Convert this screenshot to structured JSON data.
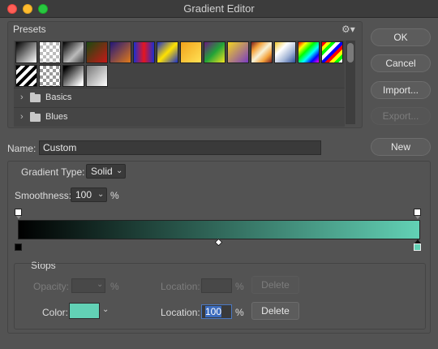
{
  "window": {
    "title": "Gradient Editor"
  },
  "presets": {
    "title": "Presets",
    "gear_icon": "gear-icon",
    "swatches": [
      "linear-gradient(135deg,#000,#fff)",
      "repeating-conic-gradient(#bbb 0 25%,#fff 0 50%) 0 0/8px 8px",
      "linear-gradient(135deg,#000,#bbb 60%,rgba(255,255,255,0))",
      "linear-gradient(135deg,#1b4a0f,#c81818)",
      "linear-gradient(135deg,#22177a,#e07a1a)",
      "linear-gradient(90deg,#1c2fd0,#e6151e,#1c2fd0)",
      "linear-gradient(135deg,#1b2fc9,#ffe200,#1b2fc9)",
      "linear-gradient(135deg,#f2a21b,#ffe255)",
      "linear-gradient(135deg,#6a1a7e,#22a338,#f3e521)",
      "linear-gradient(135deg,#f3d421,#7a3cc2)",
      "linear-gradient(135deg,#7a1e1e,#f4a23b,#f7f2d8,#f4a23b,#7a1e1e)",
      "linear-gradient(135deg,#f1c72c,#fff,#a3b5d6,#2d4f9a)",
      "linear-gradient(135deg,#ff0000,#ffff00,#00ff00,#00ffff,#0000ff,#ff00ff)",
      "repeating-linear-gradient(135deg,#ff0000 0 4px,#ffff00 4px 8px,#00ff00 8px 12px,#ffffff 12px 16px,#0000ff 16px 20px)",
      "repeating-linear-gradient(135deg,#000 0 4px,#fff 4px 8px)",
      "repeating-conic-gradient(#9a9a9a 0 25%,#fff 0 50%) 0 0/8px 8px",
      "linear-gradient(135deg,#000 10%,#fff 90%)",
      "linear-gradient(135deg,#777,#fff)"
    ],
    "folders": [
      {
        "label": "Basics"
      },
      {
        "label": "Blues"
      }
    ]
  },
  "buttons": {
    "ok": "OK",
    "cancel": "Cancel",
    "import": "Import...",
    "export": "Export...",
    "new": "New"
  },
  "name_field": {
    "label": "Name:",
    "value": "Custom"
  },
  "gradient": {
    "type_label": "Gradient Type:",
    "type_value": "Solid",
    "smoothness_label": "Smoothness:",
    "smoothness_value": "100",
    "smoothness_unit": "%",
    "start_color": "#000000",
    "end_color": "#62d1b5"
  },
  "stops": {
    "title": "Stops",
    "opacity_label": "Opacity:",
    "opacity_unit": "%",
    "opacity_location_label": "Location:",
    "opacity_location_unit": "%",
    "opacity_delete": "Delete",
    "color_label": "Color:",
    "color_value": "#62d1b5",
    "color_location_label": "Location:",
    "color_location_value": "100",
    "color_location_unit": "%",
    "color_delete": "Delete"
  }
}
